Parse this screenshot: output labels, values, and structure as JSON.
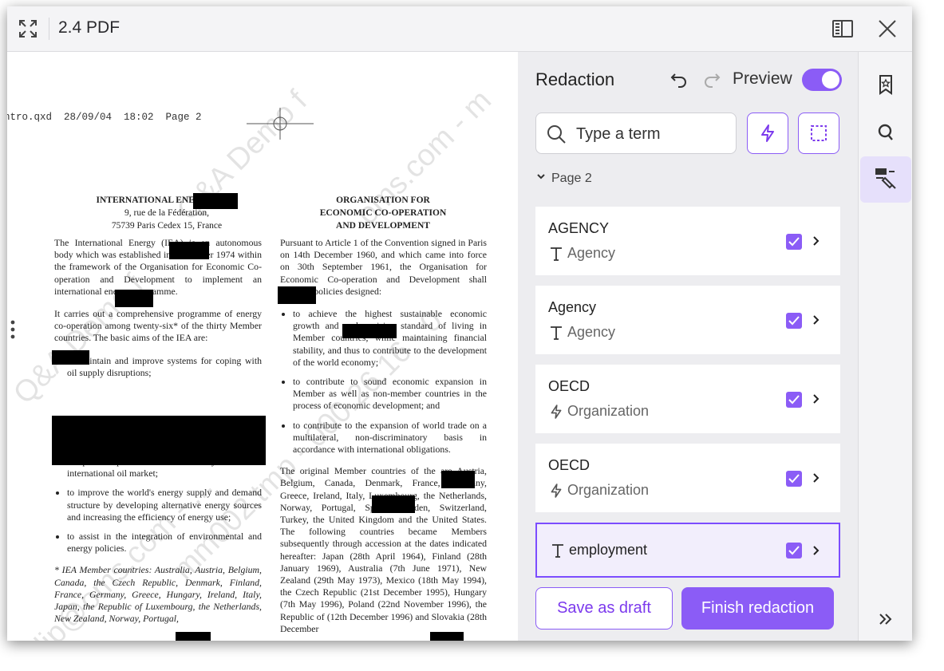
{
  "window": {
    "title": "2.4 PDF"
  },
  "document": {
    "file_line": "ntro.qxd  28/09/04  18:02  Page 2",
    "watermark_1": "Q&A Demo f",
    "watermark_2": "oms.com - m",
    "watermark_3": "mm002.tmp - 000.26.16 - 0",
    "watermark_4": "Q&A Demo f",
    "watermark_5": "j.filip@oms.com - ...",
    "left_header": [
      "INTERNATIONAL ENERGY",
      "9, rue de la Fédération,",
      "75739 Paris Cedex 15, France"
    ],
    "right_header": [
      "ORGANISATION FOR",
      "ECONOMIC CO-OPERATION",
      "AND DEVELOPMENT"
    ],
    "left_p1": "The International Energy (IEA) is an autonomous body which was established in November 1974 within the framework of the Organisation for Economic Co-operation and Development to implement an international energy programme.",
    "left_p2": "It carries out a comprehensive programme of energy co-operation among twenty-six* of the thirty Member countries. The basic aims of the IEA are:",
    "left_b1": "to maintain and improve systems for coping with oil supply disruptions;",
    "left_b2": "to operate a permanent information system on the international oil market;",
    "left_b3": "to improve the world's energy supply and demand structure by developing alternative energy sources and increasing the efficiency of energy use;",
    "left_b4": "to assist in the integration of environmental and energy policies.",
    "left_foot": "* IEA Member countries: Australia, Austria, Belgium, Canada, the Czech Republic, Denmark, Finland, France, Germany, Greece, Hungary, Ireland, Italy, Japan, the Republic of Luxembourg, the Netherlands, New Zealand, Norway, Portugal,",
    "right_p1": "Pursuant to Article 1 of the Convention signed in Paris on 14th December 1960, and which came into force on 30th September 1961, the Organisation for Economic Co-operation and Development shall promote policies designed:",
    "right_b1": "to achieve the highest sustainable economic growth and and a rising standard of living in Member countries, while maintaining financial stability, and thus to contribute to the development of the world economy;",
    "right_b2": "to contribute to sound economic expansion in Member as well as non-member countries in the process of economic development; and",
    "right_b3": "to contribute to the expansion of world trade on a multilateral, non-discriminatory basis in accordance with international obligations.",
    "right_p2": "The original Member countries of the are Austria, Belgium, Canada, Denmark, France, Germany, Greece, Ireland, Italy, Luxembourg, the Netherlands, Norway, Portugal, Spain, Sweden, Switzerland, Turkey, the United Kingdom and the United States. The following countries became Members subsequently through accession at the dates indicated hereafter: Japan (28th April 1964), Finland (28th January 1969), Australia (7th June 1971), New Zealand (29th May 1973), Mexico (18th May 1994), the Czech Republic (21st December 1995), Hungary (7th May 1996), Poland (22nd November 1996), the Republic of (12th December 1996) and Slovakia (28th December"
  },
  "panel": {
    "title": "Redaction",
    "preview_label": "Preview",
    "search_placeholder": "Type a term",
    "page_label": "Page 2",
    "items": [
      {
        "name": "AGENCY",
        "type": "Agency",
        "icon": "text-icon"
      },
      {
        "name": "Agency",
        "type": "Agency",
        "icon": "text-icon"
      },
      {
        "name": "OECD",
        "type": "Organization",
        "icon": "bolt-icon"
      },
      {
        "name": "OECD",
        "type": "Organization",
        "icon": "bolt-icon"
      },
      {
        "name": "employment",
        "type": "",
        "icon": "text-icon"
      }
    ],
    "save_draft_label": "Save as draft",
    "finish_label": "Finish redaction"
  },
  "colors": {
    "accent": "#8b5cf6",
    "panel_bg": "#ededf0",
    "rail_active": "#e6e0fb"
  }
}
